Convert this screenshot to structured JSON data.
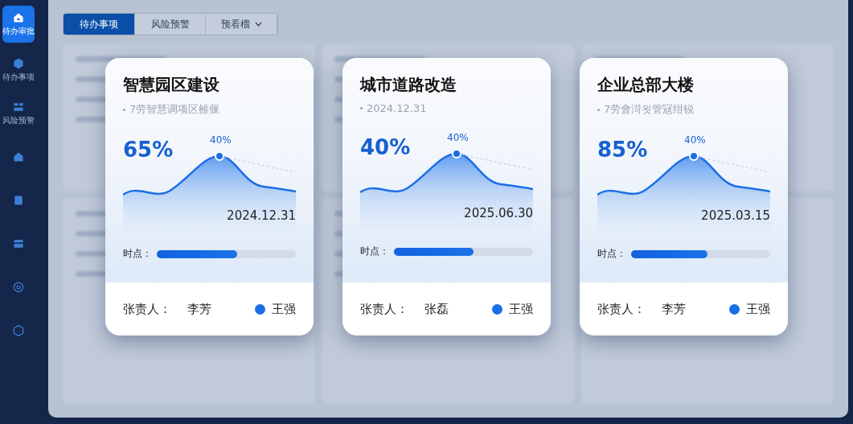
{
  "sidebar": {
    "items": [
      {
        "label": "待办审批",
        "selected": true
      },
      {
        "label": "待办事项",
        "selected": false
      },
      {
        "label": "风险预警",
        "selected": false
      },
      {
        "selected": false
      },
      {
        "selected": false
      },
      {
        "selected": false
      },
      {
        "selected": false
      },
      {
        "selected": false
      }
    ]
  },
  "tabs": [
    {
      "label": "待办事项",
      "selected": true
    },
    {
      "label": "风险预警",
      "selected": false
    },
    {
      "label": "预看榴",
      "selected": false,
      "dropdown": true
    }
  ],
  "cards": [
    {
      "title": "智慧园区建设",
      "subtitle": "7劳智慧调项区雒偃",
      "percent": "65%",
      "peak_label": "40%",
      "date": "2024.12.31",
      "progress_label": "时点：",
      "level": 0.58,
      "owner_label": "张责人：",
      "owner": "李芳",
      "assignee": "王强"
    },
    {
      "title": "城市道路改造",
      "subtitle": "2024.12.31",
      "percent": "40%",
      "peak_label": "40%",
      "date": "2025.06.30",
      "progress_label": "时点：",
      "level": 0.57,
      "owner_label": "张责人：",
      "owner": "张磊",
      "assignee": "王强"
    },
    {
      "title": "企业总部大楼",
      "subtitle": "7劳會渮욋管冦绀锐",
      "percent": "85%",
      "peak_label": "40%",
      "date": "2025.03.15",
      "progress_label": "时点：",
      "level": 0.55,
      "owner_label": "张责人：",
      "owner": "李芳",
      "assignee": "王强"
    }
  ]
}
